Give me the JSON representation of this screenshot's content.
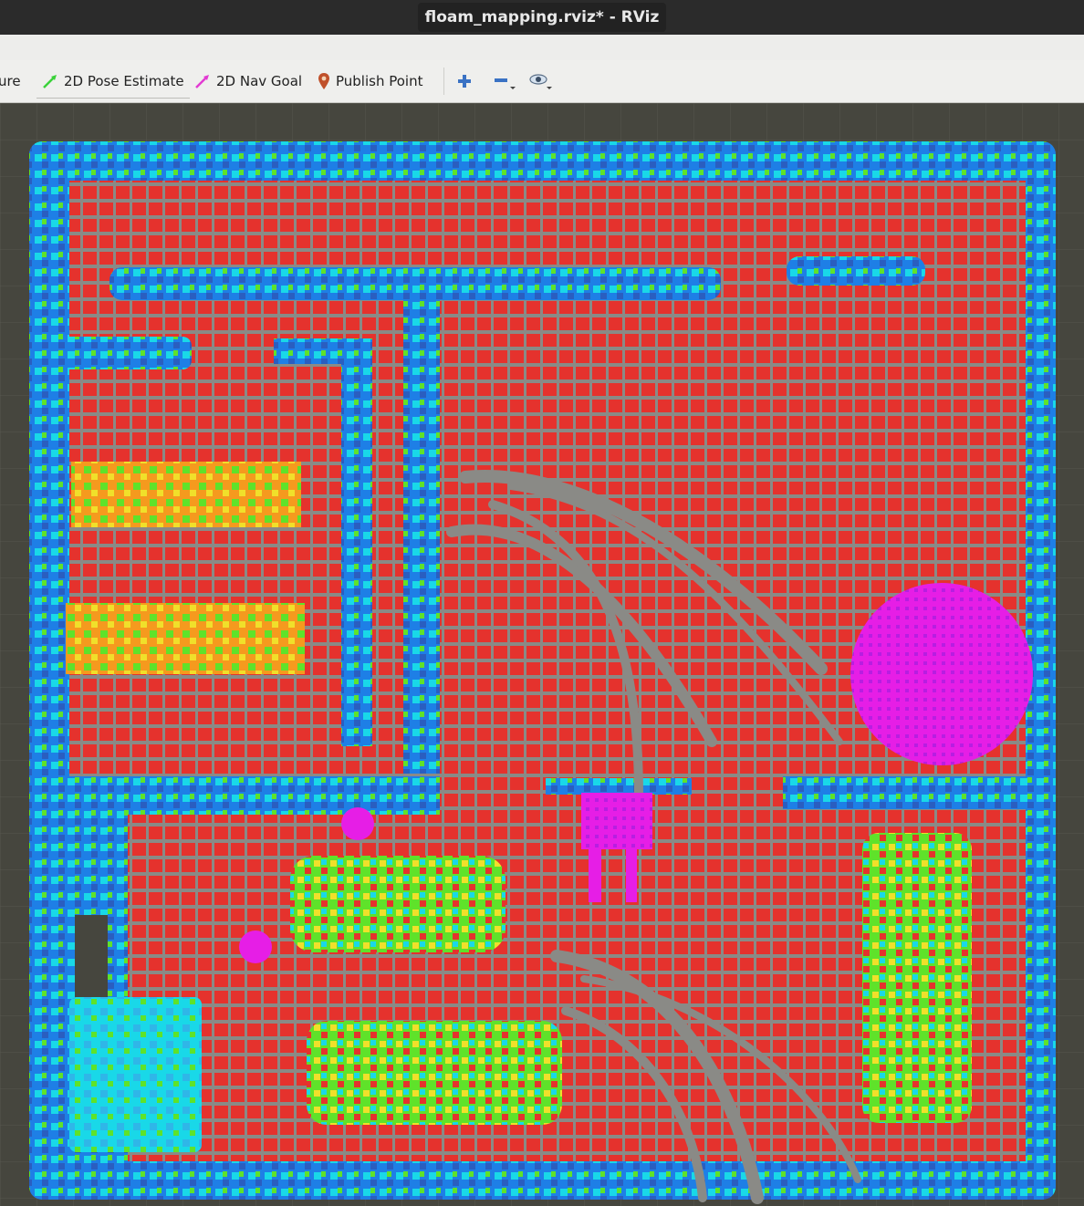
{
  "window": {
    "title": "floam_mapping.rviz* - RViz"
  },
  "toolbar": {
    "items": [
      {
        "label": "ure",
        "icon": "interact-tool-icon"
      },
      {
        "label": "2D Pose Estimate",
        "icon": "pose-estimate-arrow-icon"
      },
      {
        "label": "2D Nav Goal",
        "icon": "nav-goal-arrow-icon"
      },
      {
        "label": "Publish Point",
        "icon": "map-pin-icon"
      }
    ],
    "add_tool_icon": "plus-icon",
    "remove_tool_icon": "minus-icon",
    "view_icon": "eye-icon"
  },
  "viewport": {
    "content": "3D occupancy grid map render"
  },
  "colors": {
    "background": "#46463e",
    "floor": "#e5322d",
    "wall_blue": "#1e7fe6",
    "wall_cyan": "#19d8e8",
    "green": "#5fe22a",
    "orange": "#f59a1e",
    "yellow": "#f0e02a",
    "magenta": "#e61ee6",
    "gray_path": "#8a8a86",
    "pose_green": "#3ad23a",
    "goal_magenta": "#e23ad2",
    "pin_brown": "#c0502a"
  }
}
